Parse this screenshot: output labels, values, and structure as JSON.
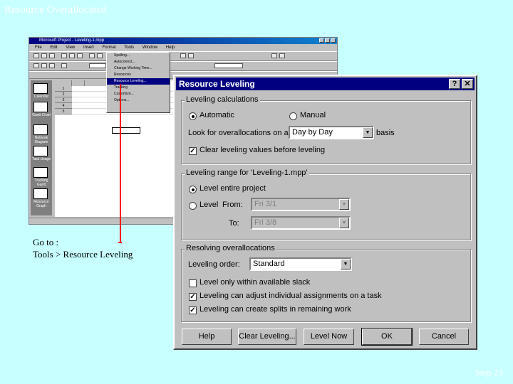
{
  "slide": {
    "title": "Resource Overallocated",
    "page_number": "Step 23"
  },
  "background_app": {
    "title": "Microsoft Project - Leveling-1.mpp",
    "menu": [
      "File",
      "Edit",
      "View",
      "Insert",
      "Format",
      "Tools",
      "Window",
      "Help"
    ],
    "tools_menu_items": [
      "Spelling...",
      "Autocorrect...",
      "Change Working Time...",
      "Resources",
      "Resource Leveling...",
      "Tracking",
      "Customize...",
      "Options..."
    ],
    "view_bar": [
      "Calendar",
      "Gantt Chart",
      "Network Diagram",
      "Task Usage",
      "Tracking Gantt",
      "Resource Graph"
    ],
    "row_numbers": [
      "1",
      "2",
      "3",
      "4",
      "5"
    ]
  },
  "instruction": {
    "line1": "Go to :",
    "line2": "Tools > Resource Leveling"
  },
  "dialog": {
    "title": "Resource Leveling",
    "help_btn": "?",
    "close_btn": "✕",
    "calc": {
      "group": "Leveling calculations",
      "automatic": "Automatic",
      "manual": "Manual",
      "look_for": "Look for overallocations on a",
      "basis_value": "Day by Day",
      "basis": "basis",
      "clear_values": "Clear leveling values before leveling",
      "mode": "automatic",
      "clear_checked": true
    },
    "range": {
      "group": "Leveling range for 'Leveling-1.mpp'",
      "entire": "Level entire project",
      "level": "Level",
      "from": "From:",
      "from_value": "Fri 3/1",
      "to": "To:",
      "to_value": "Fri 3/8",
      "mode": "entire"
    },
    "resolve": {
      "group": "Resolving overallocations",
      "order_label": "Leveling order:",
      "order_value": "Standard",
      "within_slack": "Level only within available slack",
      "adjust_assignments": "Leveling can adjust individual assignments on a task",
      "create_splits": "Leveling can create splits in remaining work",
      "within_slack_checked": false,
      "adjust_checked": true,
      "splits_checked": true
    },
    "buttons": {
      "help": "Help",
      "clear": "Clear Leveling...",
      "level_now": "Level Now",
      "ok": "OK",
      "cancel": "Cancel"
    }
  }
}
